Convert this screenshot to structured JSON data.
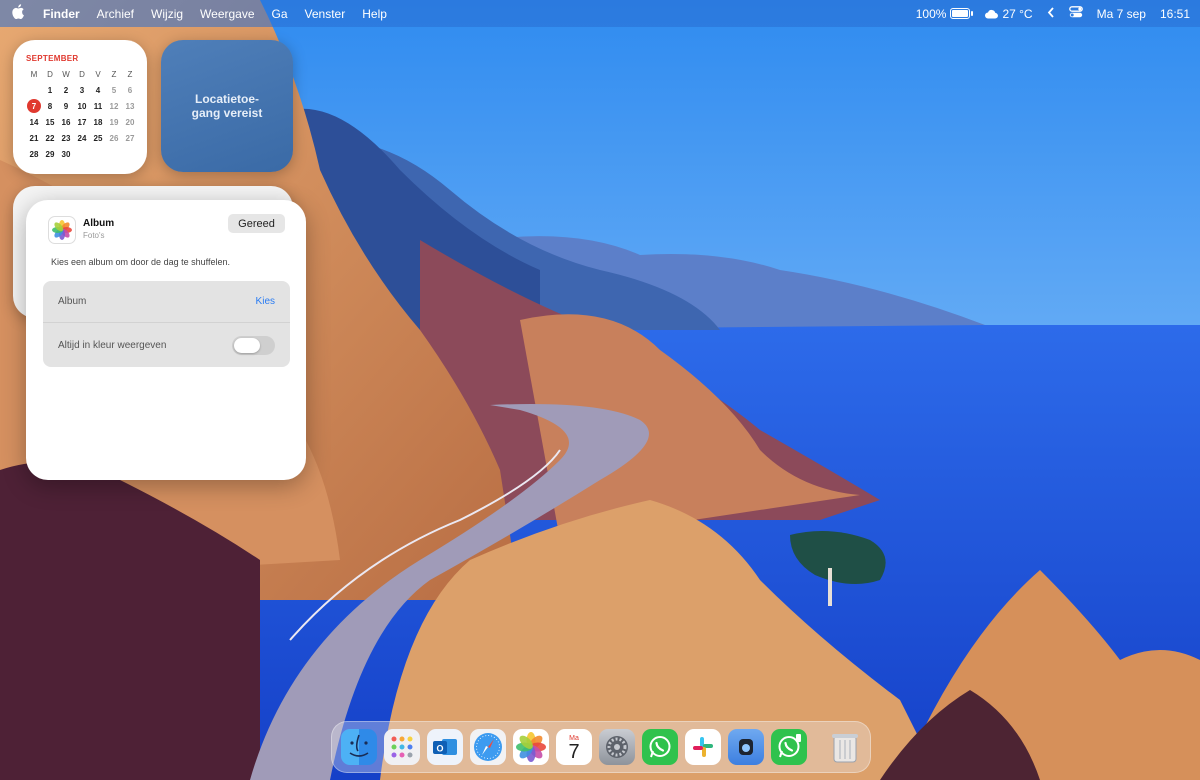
{
  "menubar": {
    "apple_icon": "apple-logo-icon",
    "app_name": "Finder",
    "menus": [
      "Archief",
      "Wijzig",
      "Weergave",
      "Ga",
      "Venster",
      "Help"
    ],
    "battery_percent": "100%",
    "battery_level": 1.0,
    "weather_icon": "cloud-icon",
    "temperature": "27 °C",
    "date": "Ma 7 sep",
    "time": "16:51"
  },
  "calendar_widget": {
    "month": "SEPTEMBER",
    "weekdays": [
      "M",
      "D",
      "W",
      "D",
      "V",
      "Z",
      "Z"
    ],
    "weeks": [
      [
        "",
        "1",
        "2",
        "3",
        "4",
        "5",
        "6"
      ],
      [
        "7",
        "8",
        "9",
        "10",
        "11",
        "12",
        "13"
      ],
      [
        "14",
        "15",
        "16",
        "17",
        "18",
        "19",
        "20"
      ],
      [
        "21",
        "22",
        "23",
        "24",
        "25",
        "26",
        "27"
      ],
      [
        "28",
        "29",
        "30",
        "",
        "",
        "",
        ""
      ]
    ],
    "today": "7"
  },
  "location_widget": {
    "text": "Locatietoe-gang vereist"
  },
  "album_widget": {
    "icon": "photos-app-icon",
    "title": "Album",
    "subtitle": "Foto's",
    "done_button": "Gereed",
    "description": "Kies een album om door de dag te shuffelen.",
    "album_label": "Album",
    "album_action": "Kies",
    "color_label": "Altijd in kleur weergeven",
    "color_toggle_on": false,
    "accent_color": "#2a7cf3"
  },
  "dock": {
    "apps": [
      {
        "name": "Finder",
        "icon": "finder-icon"
      },
      {
        "name": "Launchpad",
        "icon": "launchpad-icon"
      },
      {
        "name": "Outlook",
        "icon": "outlook-icon"
      },
      {
        "name": "Safari",
        "icon": "safari-icon"
      },
      {
        "name": "Foto's",
        "icon": "photos-icon"
      },
      {
        "name": "Agenda",
        "icon": "calendar-icon",
        "day_label": "Ma",
        "day_number": "7"
      },
      {
        "name": "Systeeminstellingen",
        "icon": "settings-gear-icon"
      },
      {
        "name": "WhatsApp",
        "icon": "whatsapp-icon"
      },
      {
        "name": "Slack",
        "icon": "slack-icon"
      },
      {
        "name": "Keyboard Maestro",
        "icon": "app-icon"
      },
      {
        "name": "WhatsApp Beta",
        "icon": "whatsapp-beta-icon"
      }
    ],
    "trash": {
      "name": "Prullenmand",
      "icon": "trash-icon"
    }
  }
}
